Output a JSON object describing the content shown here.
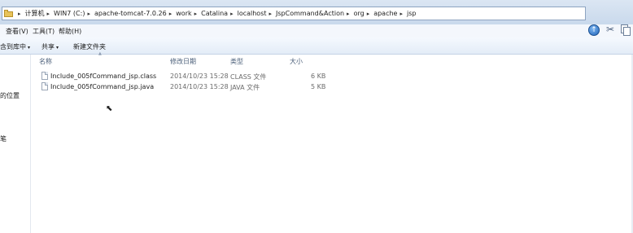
{
  "address_bar": {
    "crumbs": [
      "计算机",
      "WIN7 (C:)",
      "apache-tomcat-7.0.26",
      "work",
      "Catalina",
      "localhost",
      "JspCommand&Action",
      "org",
      "apache",
      "jsp"
    ],
    "separator": "▸"
  },
  "menu": {
    "items": [
      "查看(V)",
      "工具(T)",
      "帮助(H)"
    ]
  },
  "commands": {
    "include_library": "含到库中",
    "share": "共享",
    "new_folder": "新建文件夹",
    "dropdown_caret": "▾"
  },
  "nav": {
    "items": [
      "的位置",
      "笔"
    ]
  },
  "columns": {
    "name": "名称",
    "modified": "修改日期",
    "type": "类型",
    "size": "大小"
  },
  "files": [
    {
      "name": "Include_005fCommand_jsp.class",
      "modified": "2014/10/23 15:28",
      "type": "CLASS 文件",
      "size": "6 KB"
    },
    {
      "name": "Include_005fCommand_jsp.java",
      "modified": "2014/10/23 15:28",
      "type": "JAVA 文件",
      "size": "5 KB"
    }
  ],
  "icons": {
    "up": "up-arrow-icon",
    "tools": "scissors-icon",
    "pages": "copy-pages-icon",
    "cursor": "mouse-cursor"
  }
}
